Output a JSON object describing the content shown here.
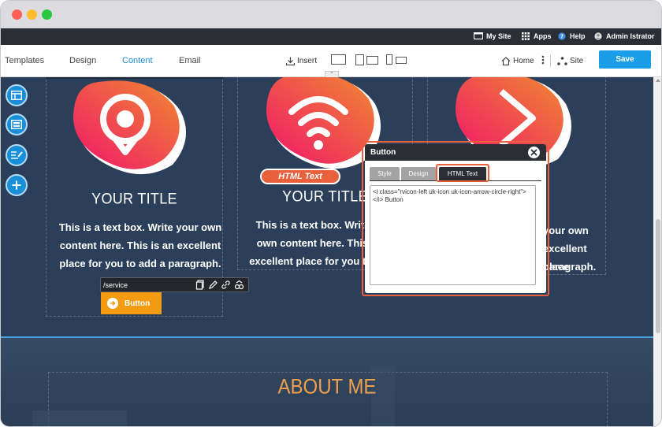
{
  "adminbar": {
    "my_site": "My Site",
    "apps": "Apps",
    "help": "Help",
    "user": "Admin Istrator"
  },
  "toolbar": {
    "tabs": [
      "Templates",
      "Design",
      "Content",
      "Email"
    ],
    "active_tab": "Content",
    "insert": "Insert",
    "home": "Home",
    "site": "Site",
    "save": "Save"
  },
  "cards": [
    {
      "title": "YOUR TITLE",
      "text": "This is a text box. Write your own content here. This is an excellent place for you to add a paragraph."
    },
    {
      "title": "YOUR TITLE",
      "text": "This is a text box. Write your own content here. This is an excellent place for you to add a paragraph."
    },
    {
      "title": "",
      "text_fragments": [
        "your own",
        "excellent place",
        "paragraph."
      ]
    }
  ],
  "linkbar": {
    "path": "/service"
  },
  "page_button": {
    "label": "Button"
  },
  "html_label": "HTML Text",
  "popup": {
    "title": "Button",
    "tabs": [
      "Style",
      "Design",
      "HTML Text"
    ],
    "active_tab": "HTML Text",
    "html_value": "<i class=\"rvicon-left uk-icon uk-icon-arrow-circle-right\"></i> Button"
  },
  "about": {
    "title": "ABOUT ME"
  },
  "colors": {
    "accent_blue": "#1a9ee7",
    "highlight_orange": "#e8603c",
    "button_orange": "#f39c12",
    "canvas_navy": "#2b3f5a",
    "about_orange": "#f0a04b"
  },
  "icons": [
    "monitor-icon",
    "apps-grid-icon",
    "help-icon",
    "user-avatar-icon",
    "download-icon",
    "desktop-icon",
    "tablet-icon",
    "mobile-icon",
    "home-icon",
    "more-vertical-icon",
    "sitemap-icon",
    "layout-icon",
    "section-icon",
    "edit-list-icon",
    "plus-icon",
    "location-pin-icon",
    "wifi-icon",
    "play-icon",
    "copy-icon",
    "pencil-icon",
    "link-icon",
    "unlink-icon",
    "arrow-circle-right-icon",
    "close-icon"
  ]
}
